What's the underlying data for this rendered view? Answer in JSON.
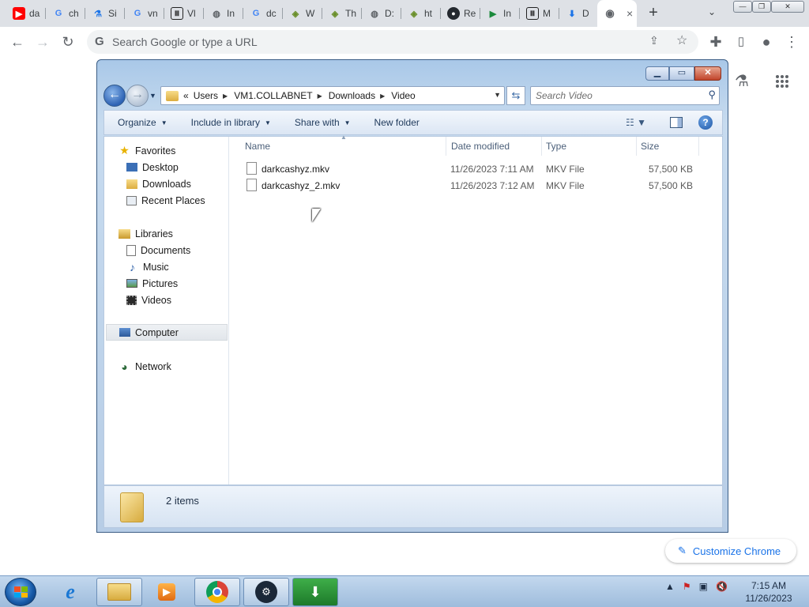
{
  "browser": {
    "tabs": [
      {
        "label": "da",
        "icon": "youtube-icon",
        "color": "#ff0000"
      },
      {
        "label": "ch",
        "icon": "google-icon",
        "color": "#4285f4"
      },
      {
        "label": "Si",
        "icon": "labs-flask-icon",
        "color": "#1a73e8"
      },
      {
        "label": "vn",
        "icon": "google-icon",
        "color": "#4285f4"
      },
      {
        "label": "Vl",
        "icon": "archive-icon",
        "color": "#222222"
      },
      {
        "label": "In",
        "icon": "globe-icon",
        "color": "#5f6368"
      },
      {
        "label": "dc",
        "icon": "google-icon",
        "color": "#4285f4"
      },
      {
        "label": "W",
        "icon": "web-icon",
        "color": "#6a8f2a"
      },
      {
        "label": "Th",
        "icon": "web-icon",
        "color": "#6a8f2a"
      },
      {
        "label": "D:",
        "icon": "globe-icon",
        "color": "#5f6368"
      },
      {
        "label": "ht",
        "icon": "web-icon",
        "color": "#6a8f2a"
      },
      {
        "label": "Re",
        "icon": "github-icon",
        "color": "#24292f"
      },
      {
        "label": "In",
        "icon": "play-icon",
        "color": "#1b8a3c"
      },
      {
        "label": "M",
        "icon": "archive-icon",
        "color": "#222222"
      },
      {
        "label": "D",
        "icon": "download-icon",
        "color": "#1a73e8"
      }
    ],
    "active_tab": {
      "icon": "chrome-blank-icon",
      "close": "×"
    },
    "new_tab": "+",
    "tab_search": "⌄",
    "window_controls": {
      "minimize": "—",
      "restore": "❐",
      "close": "✕"
    },
    "omnibox": {
      "placeholder": "Search Google or type a URL",
      "g_icon": "G"
    },
    "customize_label": "Customize Chrome"
  },
  "explorer": {
    "breadcrumb": [
      "«",
      "Users",
      "VM1.COLLABNET",
      "Downloads",
      "Video"
    ],
    "search_placeholder": "Search Video",
    "commands": {
      "organize": "Organize",
      "include_in_library": "Include in library",
      "share_with": "Share with",
      "new_folder": "New folder"
    },
    "nav": {
      "favorites": "Favorites",
      "desktop": "Desktop",
      "downloads": "Downloads",
      "recent_places": "Recent Places",
      "libraries": "Libraries",
      "documents": "Documents",
      "music": "Music",
      "pictures": "Pictures",
      "videos": "Videos",
      "computer": "Computer",
      "network": "Network"
    },
    "columns": {
      "name": "Name",
      "date_modified": "Date modified",
      "type": "Type",
      "size": "Size"
    },
    "files": [
      {
        "name": "darkcashyz.mkv",
        "date": "11/26/2023 7:11 AM",
        "type": "MKV File",
        "size": "57,500 KB"
      },
      {
        "name": "darkcashyz_2.mkv",
        "date": "11/26/2023 7:12 AM",
        "type": "MKV File",
        "size": "57,500 KB"
      }
    ],
    "status": "2 items"
  },
  "taskbar": {
    "clock_time": "7:15 AM",
    "clock_date": "11/26/2023",
    "apps": [
      "internet-explorer-icon",
      "file-explorer-icon",
      "media-player-icon",
      "chrome-icon",
      "steam-icon",
      "download-manager-icon"
    ]
  }
}
